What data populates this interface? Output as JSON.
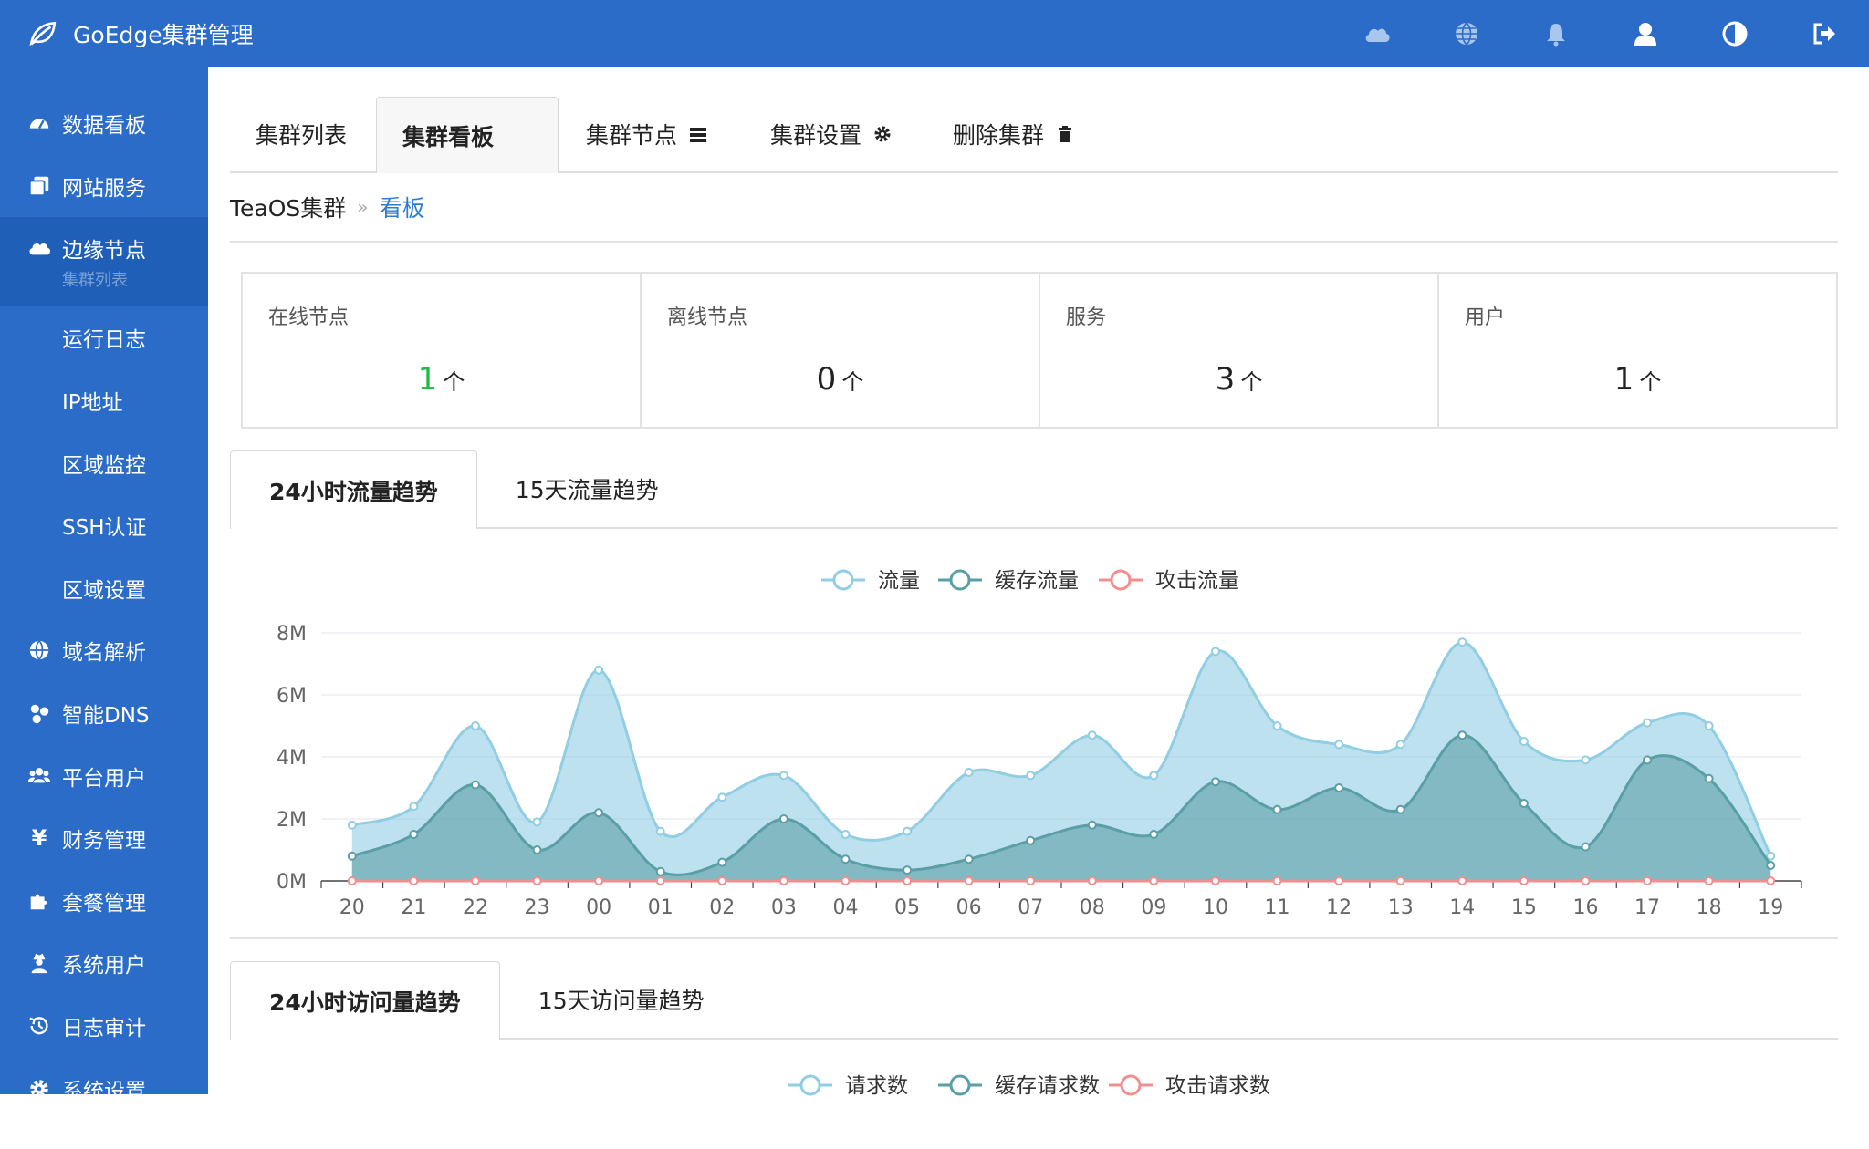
{
  "app": {
    "title": "GoEdge集群管理"
  },
  "top_icons": [
    "cloud-icon",
    "globe-icon",
    "bell-icon",
    "user-icon",
    "contrast-icon",
    "logout-icon"
  ],
  "sidebar": {
    "items": [
      {
        "label": "数据看板",
        "icon": "dashboard-icon"
      },
      {
        "label": "网站服务",
        "icon": "clone-icon"
      },
      {
        "label": "边缘节点",
        "icon": "cloud-icon",
        "sub": "集群列表",
        "active": true
      },
      {
        "label": "运行日志"
      },
      {
        "label": "IP地址"
      },
      {
        "label": "区域监控"
      },
      {
        "label": "SSH认证"
      },
      {
        "label": "区域设置"
      },
      {
        "label": "域名解析",
        "icon": "globe-icon"
      },
      {
        "label": "智能DNS",
        "icon": "network-icon"
      },
      {
        "label": "平台用户",
        "icon": "users-icon"
      },
      {
        "label": "财务管理",
        "icon": "yen-icon"
      },
      {
        "label": "套餐管理",
        "icon": "puzzle-icon"
      },
      {
        "label": "系统用户",
        "icon": "user-secret-icon"
      },
      {
        "label": "日志审计",
        "icon": "history-icon"
      },
      {
        "label": "系统设置",
        "icon": "gear-icon"
      }
    ]
  },
  "tabs": [
    {
      "label": "集群列表"
    },
    {
      "label": "集群看板",
      "active": true
    },
    {
      "label": "集群节点",
      "icon": "server-icon"
    },
    {
      "label": "集群设置",
      "icon": "gear-icon"
    },
    {
      "label": "删除集群",
      "icon": "trash-icon"
    }
  ],
  "breadcrumb": {
    "cluster": "TeaOS集群",
    "separator": "»",
    "current": "看板"
  },
  "stats": [
    {
      "label": "在线节点",
      "value": "1",
      "unit": "个",
      "color": "#21ba45"
    },
    {
      "label": "离线节点",
      "value": "0",
      "unit": "个"
    },
    {
      "label": "服务",
      "value": "3",
      "unit": "个"
    },
    {
      "label": "用户",
      "value": "1",
      "unit": "个"
    }
  ],
  "traffic_tabs": [
    {
      "label": "24小时流量趋势",
      "active": true
    },
    {
      "label": "15天流量趋势"
    }
  ],
  "visits_tabs": [
    {
      "label": "24小时访问量趋势",
      "active": true
    },
    {
      "label": "15天访问量趋势"
    }
  ],
  "visits_legend": [
    "请求数",
    "缓存请求数",
    "攻击请求数"
  ],
  "chart_data": {
    "type": "area",
    "categories": [
      "20",
      "21",
      "22",
      "23",
      "00",
      "01",
      "02",
      "03",
      "04",
      "05",
      "06",
      "07",
      "08",
      "09",
      "10",
      "11",
      "12",
      "13",
      "14",
      "15",
      "16",
      "17",
      "18",
      "19"
    ],
    "y_ticks": [
      "0M",
      "2M",
      "4M",
      "6M",
      "8M"
    ],
    "ylim": [
      0,
      8
    ],
    "legend_position": "top",
    "series": [
      {
        "name": "流量",
        "color": "#91cde3",
        "values": [
          1.8,
          2.4,
          5.0,
          1.9,
          6.8,
          1.6,
          2.7,
          3.4,
          1.5,
          1.6,
          3.5,
          3.4,
          4.7,
          3.4,
          7.4,
          5.0,
          4.4,
          4.4,
          7.7,
          4.5,
          3.9,
          5.1,
          5.0,
          0.8
        ]
      },
      {
        "name": "缓存流量",
        "color": "#5a9ea6",
        "values": [
          0.8,
          1.5,
          3.1,
          1.0,
          2.2,
          0.3,
          0.6,
          2.0,
          0.7,
          0.35,
          0.7,
          1.3,
          1.8,
          1.5,
          3.2,
          2.3,
          3.0,
          2.3,
          4.7,
          2.5,
          1.1,
          3.9,
          3.3,
          0.5
        ]
      },
      {
        "name": "攻击流量",
        "color": "#f08f8f",
        "values": [
          0,
          0,
          0,
          0,
          0,
          0,
          0,
          0,
          0,
          0,
          0,
          0,
          0,
          0,
          0,
          0,
          0,
          0,
          0,
          0,
          0,
          0,
          0,
          0
        ]
      }
    ]
  }
}
